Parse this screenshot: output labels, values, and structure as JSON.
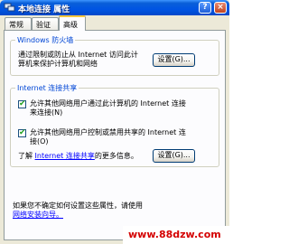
{
  "window": {
    "title": "本地连接 属性",
    "help_glyph": "?",
    "close_glyph": "×"
  },
  "tabs": [
    {
      "label": "常规"
    },
    {
      "label": "验证"
    },
    {
      "label": "高级",
      "selected": true
    }
  ],
  "firewall": {
    "group_title": "Windows 防火墙",
    "description_line1": "通过限制或防止从 Internet 访问此计",
    "description_line2": "算机来保护计算机和网络",
    "settings_button": "设置(G)..."
  },
  "ics": {
    "group_title": "Internet 连接共享",
    "option1_line1": "允许其他网络用户通过此计算机的 Internet 连接",
    "option1_line2": "来连接(N)",
    "option1_checked": true,
    "option2_line1": "允许其他网络用户控制或禁用共享的 Internet 连",
    "option2_line2": "接(O)",
    "option2_checked": true,
    "learn_prefix": "了解",
    "learn_link": "Internet 连接共享",
    "learn_suffix": "的更多信息。",
    "settings_button": "设置(G)..."
  },
  "footer": {
    "line1": "如果您不确定如何设置这些属性，请使用",
    "line2": "网络安装向导。"
  },
  "watermark": "www.88dzw.com"
}
